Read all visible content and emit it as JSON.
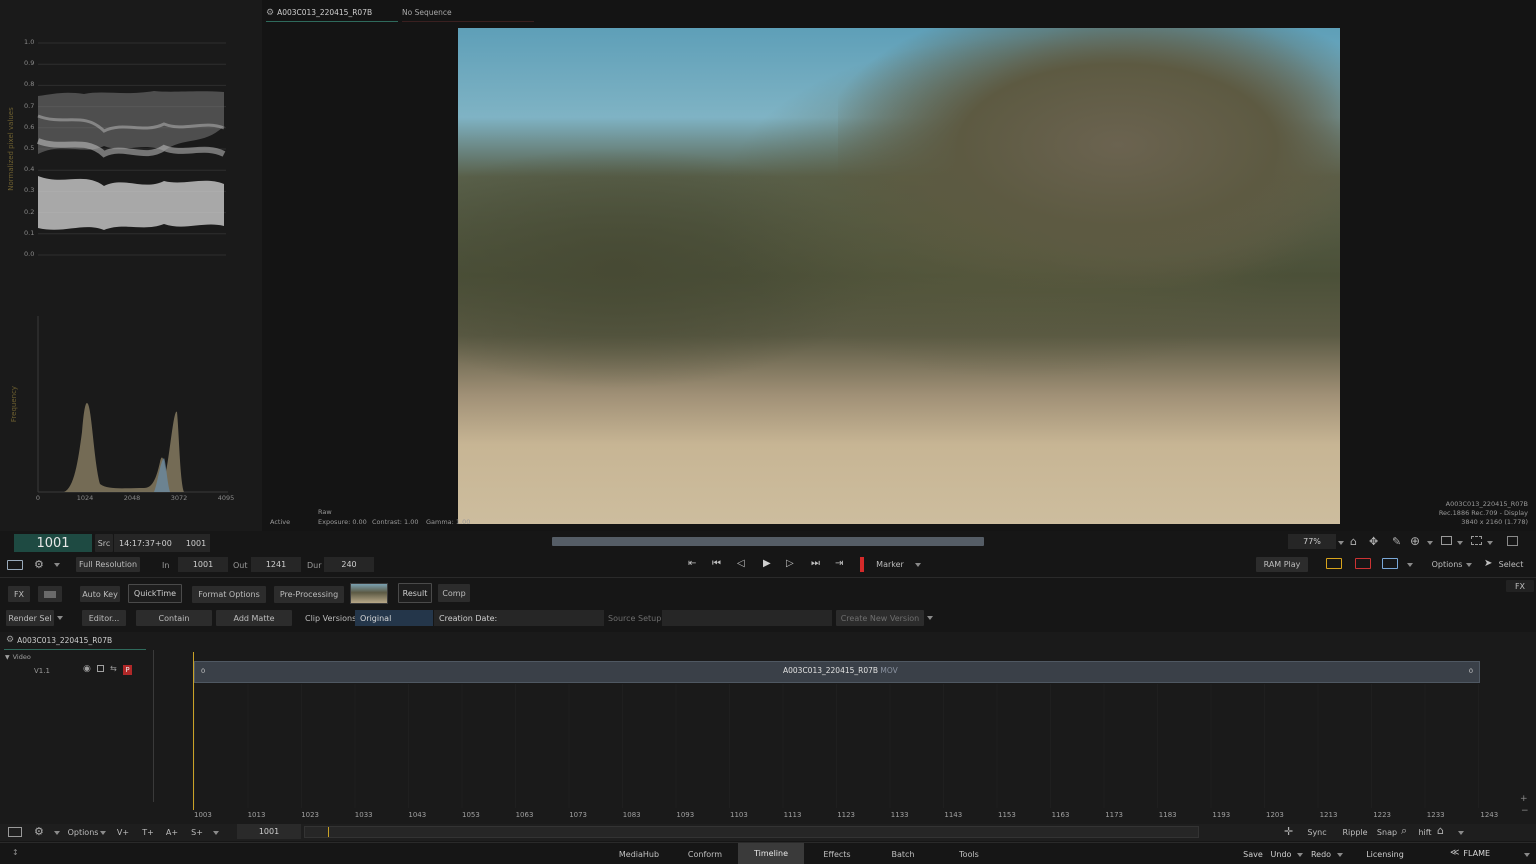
{
  "viewer_tabs": {
    "clip_tab": "A003C013_220415_R07B",
    "sequence_tab": "No Sequence"
  },
  "scopes": {
    "waveform_ylabel": "Normalized pixel values",
    "waveform_ticks": [
      "1.0",
      "0.9",
      "0.8",
      "0.7",
      "0.6",
      "0.5",
      "0.4",
      "0.3",
      "0.2",
      "0.1",
      "0.0"
    ],
    "histogram_ylabel": "Frequency",
    "histogram_ticks": [
      "0",
      "1024",
      "2048",
      "3072",
      "4095"
    ]
  },
  "viewer_status": {
    "mode": "Active",
    "raw_label": "Raw",
    "exposure": "Exposure: 0.00",
    "contrast": "Contrast: 1.00",
    "gamma": "Gamma: 1.00",
    "clip_name": "A003C013_220415_R07B",
    "colorspace": "Rec.1886 Rec.709 - Display",
    "resolution": "3840 x 2160 (1.778)"
  },
  "transport": {
    "frame": "1001",
    "src_label": "Src",
    "timecode": "14:17:37+00",
    "src_frame": "1001",
    "zoom": "77%",
    "resolution_btn": "Full Resolution",
    "in_label": "In",
    "in_value": "1001",
    "out_label": "Out",
    "out_value": "1241",
    "dur_label": "Dur",
    "dur_value": "240",
    "marker": "Marker",
    "ram_play": "RAM Play",
    "options": "Options",
    "select": "Select"
  },
  "tools": {
    "fx": "FX",
    "auto_key": "Auto Key",
    "quicktime": "QuickTime",
    "format_options": "Format Options",
    "pre_processing": "Pre-Processing",
    "result": "Result",
    "comp": "Comp",
    "fx_right": "FX",
    "render_sel": "Render Sel",
    "editor": "Editor...",
    "contain": "Contain",
    "add_matte": "Add Matte",
    "clip_versions_label": "Clip Versions",
    "clip_versions_value": "Original",
    "creation_date": "Creation Date:",
    "source_setup": "Source Setup",
    "create_new_version": "Create New Version"
  },
  "timeline": {
    "sequence_name": "A003C013_220415_R07B",
    "video_label": "Video",
    "track_name": "V1.1",
    "clip_label": "A003C013_220415_R07B",
    "clip_format": "MOV",
    "clip_start": "0",
    "clip_end": "0",
    "ruler": [
      "1003",
      "1013",
      "1023",
      "1033",
      "1043",
      "1053",
      "1063",
      "1073",
      "1083",
      "1093",
      "1103",
      "1113",
      "1123",
      "1133",
      "1143",
      "1153",
      "1163",
      "1173",
      "1183",
      "1193",
      "1203",
      "1213",
      "1223",
      "1233",
      "1243"
    ],
    "options": "Options",
    "v_plus": "V+",
    "t_plus": "T+",
    "a_plus": "A+",
    "s_plus": "S+",
    "current_frame": "1001",
    "sync": "Sync",
    "ripple": "Ripple",
    "snap": "Snap",
    "shift": "hift"
  },
  "bottom_nav": {
    "tabs": [
      "MediaHub",
      "Conform",
      "Timeline",
      "Effects",
      "Batch",
      "Tools"
    ],
    "active_tab": "Timeline",
    "save": "Save",
    "undo": "Undo",
    "redo": "Redo",
    "licensing": "Licensing",
    "product": "FLAME"
  },
  "colors": {
    "accent_green": "#1e4a42",
    "playhead": "#c9a227",
    "record_red": "#d42a2a",
    "active_tab_bg": "#3a3a3a"
  }
}
